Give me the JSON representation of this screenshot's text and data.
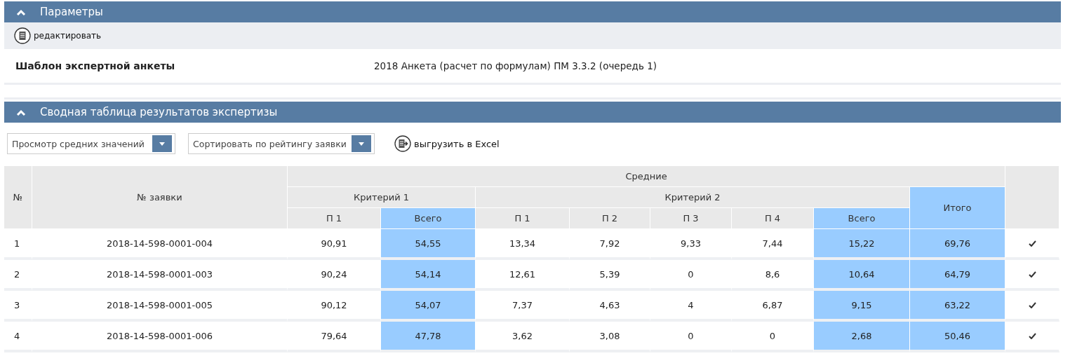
{
  "params_panel": {
    "title": "Параметры",
    "expanded": true,
    "edit_link": "редактировать",
    "fields": [
      {
        "label": "Шаблон экспертной анкеты",
        "value": "2018 Анкета (расчет по формулам) ПМ 3.3.2 (очередь 1)"
      }
    ]
  },
  "summary_panel": {
    "title": "Сводная таблица результатов экспертизы",
    "expanded": true,
    "dropdowns": [
      {
        "value": "Просмотр средних значений"
      },
      {
        "value": "Сортировать по рейтингу заявки"
      }
    ],
    "export_link": "выгрузить в Excel",
    "table": {
      "headers": {
        "number": "№",
        "application": "№ заявки",
        "group": "Средние",
        "criteria": [
          {
            "title": "Критерий 1",
            "columns": [
              {
                "label": "П 1",
                "highlighted": false
              },
              {
                "label": "Всего",
                "highlighted": true
              }
            ]
          },
          {
            "title": "Критерий 2",
            "columns": [
              {
                "label": "П 1",
                "highlighted": false
              },
              {
                "label": "П 2",
                "highlighted": false
              },
              {
                "label": "П 3",
                "highlighted": false
              },
              {
                "label": "П 4",
                "highlighted": false
              },
              {
                "label": "Всего",
                "highlighted": true
              }
            ]
          }
        ],
        "total": {
          "label": "Итого",
          "highlighted": true
        }
      },
      "rows": [
        {
          "number": "1",
          "application": "2018-14-598-0001-004",
          "values": [
            "90,91",
            "54,55",
            "13,34",
            "7,92",
            "9,33",
            "7,44",
            "15,22"
          ],
          "total": "69,76",
          "checked": true
        },
        {
          "number": "2",
          "application": "2018-14-598-0001-003",
          "values": [
            "90,24",
            "54,14",
            "12,61",
            "5,39",
            "0",
            "8,6",
            "10,64"
          ],
          "total": "64,79",
          "checked": true
        },
        {
          "number": "3",
          "application": "2018-14-598-0001-005",
          "values": [
            "90,12",
            "54,07",
            "7,37",
            "4,63",
            "4",
            "6,87",
            "9,15"
          ],
          "total": "63,22",
          "checked": true
        },
        {
          "number": "4",
          "application": "2018-14-598-0001-006",
          "values": [
            "79,64",
            "47,78",
            "3,62",
            "3,08",
            "0",
            "0",
            "2,68"
          ],
          "total": "50,46",
          "checked": true
        }
      ]
    }
  }
}
